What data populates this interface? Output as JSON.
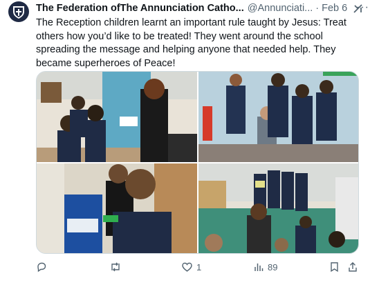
{
  "tweet": {
    "author_name": "The Federation ofThe Annunciation Catho...",
    "handle": "@Annunciati...",
    "separator": "·",
    "date": "Feb 6",
    "more_label": "···",
    "text": "The Reception children learnt an important rule taught by Jesus: Treat others how you’d like to be treated! They went around the school spreading the message and helping anyone that needed help. They became superheroes of Peace!",
    "media": [
      {
        "icon": "photo"
      },
      {
        "icon": "photo"
      },
      {
        "icon": "photo"
      },
      {
        "icon": "photo"
      }
    ],
    "actions": {
      "reply_count": "",
      "retweet_count": "",
      "like_count": "1",
      "views_count": "89"
    }
  },
  "colors": {
    "text": "#0f1419",
    "secondary": "#536471",
    "border": "#cfd9de"
  }
}
